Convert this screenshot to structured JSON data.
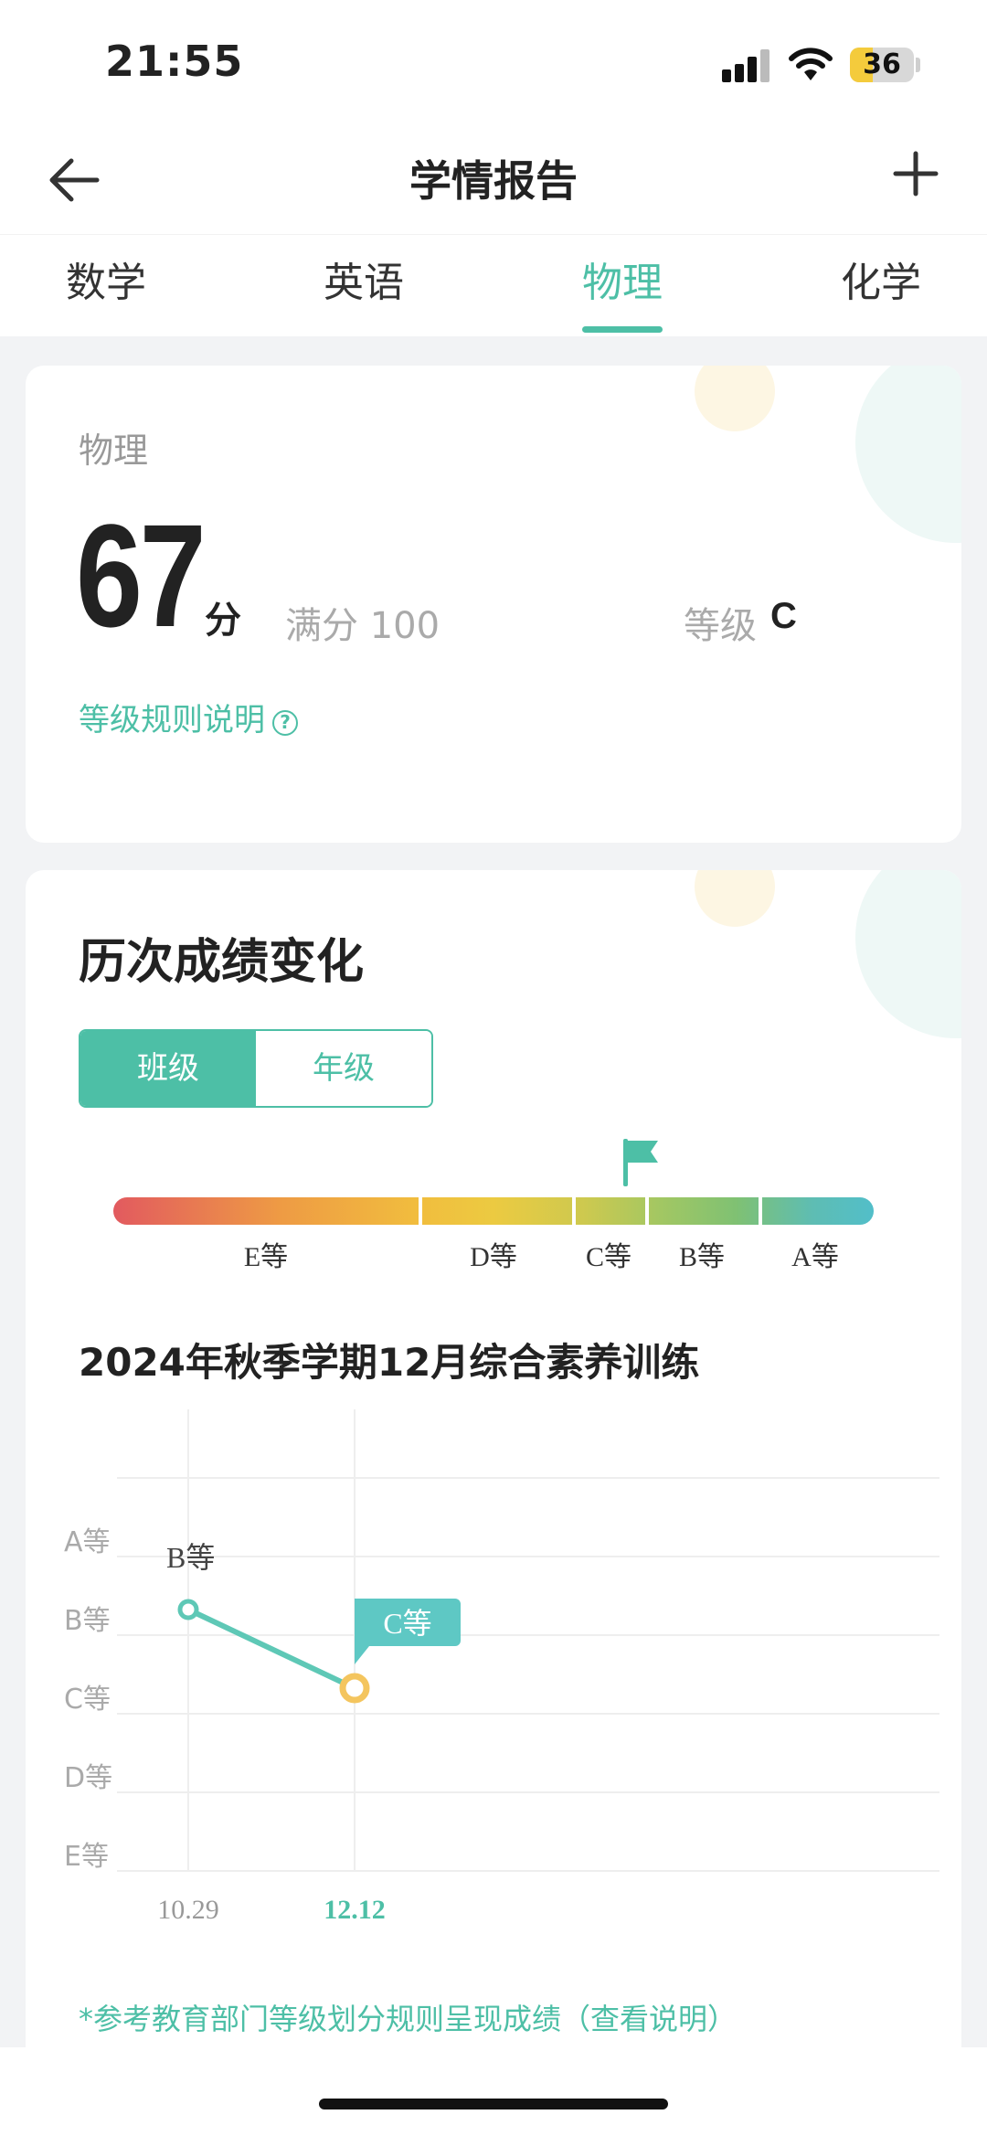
{
  "status_bar": {
    "time": "21:55",
    "battery": "36",
    "battery_level": 0.36
  },
  "header": {
    "title": "学情报告"
  },
  "tabs": [
    {
      "label": "数学",
      "active": false
    },
    {
      "label": "英语",
      "active": false
    },
    {
      "label": "物理",
      "active": true
    },
    {
      "label": "化学",
      "active": false
    }
  ],
  "score_card": {
    "subject": "物理",
    "score": "67",
    "unit": "分",
    "full_score": "满分 100",
    "grade_label": "等级",
    "grade_value": "C",
    "rule_link": "等级规则说明"
  },
  "trend": {
    "title": "历次成绩变化",
    "toggle": {
      "class_label": "班级",
      "grade_label": "年级",
      "selected": "班级"
    },
    "grade_bar": {
      "labels": [
        "E等",
        "D等",
        "C等",
        "B等",
        "A等"
      ],
      "current": "C等"
    },
    "exam_title": "2024年秋季学期12月综合素养训练",
    "disclaimer": "*参考教育部门等级划分规则呈现成绩（查看说明）"
  },
  "chart_data": {
    "type": "line",
    "y_categories": [
      "E等",
      "D等",
      "C等",
      "B等",
      "A等"
    ],
    "x": [
      "10.29",
      "12.12"
    ],
    "series": [
      {
        "values": [
          "B等",
          "C等"
        ],
        "point_labels": [
          "B等",
          "C等"
        ]
      }
    ],
    "highlight_x": "12.12",
    "colors": {
      "line": "#5ec8b6",
      "highlight": "#f4c55e",
      "label_bubble": "#5ec8c4"
    },
    "grid": true
  },
  "colors": {
    "accent": "#4dbfa6"
  }
}
